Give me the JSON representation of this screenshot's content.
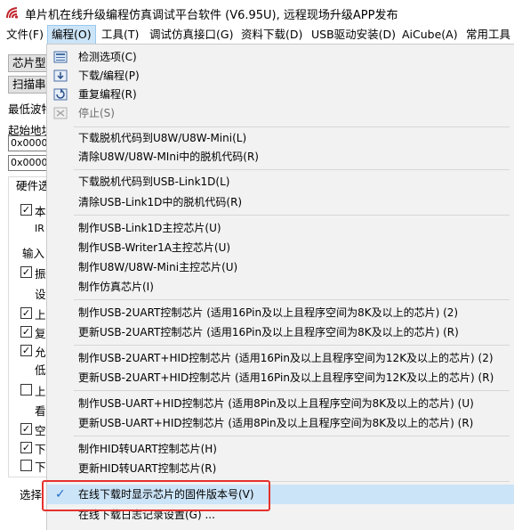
{
  "window": {
    "title": "单片机在线升级编程仿真调试平台软件 (V6.95U), 远程现场升级APP发布"
  },
  "menubar": {
    "items": [
      {
        "label": "文件(F)"
      },
      {
        "label": "编程(O)"
      },
      {
        "label": "工具(T)"
      },
      {
        "label": "调试仿真接口(G)"
      },
      {
        "label": "资料下载(D)"
      },
      {
        "label": "USB驱动安装(D)"
      },
      {
        "label": "AiCube(A)"
      },
      {
        "label": "常用工具"
      }
    ]
  },
  "background": {
    "chip_type_button": "芯片型",
    "scan_button": "扫描串",
    "min_baud_label": "最低波特",
    "start_addr_label": "起始地址",
    "addr1": "0x0000",
    "addr2": "0x0000",
    "hardware_tab": "硬件选",
    "row_labels": [
      "本",
      "IR",
      "输入",
      "振",
      "设",
      "上",
      "复",
      "允",
      "低",
      "上",
      "看",
      "空",
      "下",
      "下"
    ],
    "select_label": "选择"
  },
  "menu": {
    "items": [
      {
        "label": "检测选项(C)",
        "icon": "detect-icon",
        "disabled": false
      },
      {
        "label": "下载/编程(P)",
        "icon": "download-program-icon",
        "disabled": false
      },
      {
        "label": "重复编程(R)",
        "icon": "repeat-program-icon",
        "disabled": false
      },
      {
        "label": "停止(S)",
        "icon": "stop-icon",
        "disabled": true
      },
      {
        "label": "下载脱机代码到U8W/U8W-Mini(L)"
      },
      {
        "label": "清除U8W/U8W-MIni中的脱机代码(R)"
      },
      {
        "label": "下载脱机代码到USB-Link1D(L)"
      },
      {
        "label": "清除USB-Link1D中的脱机代码(R)"
      },
      {
        "label": "制作USB-Link1D主控芯片(U)"
      },
      {
        "label": "制作USB-Writer1A主控芯片(U)"
      },
      {
        "label": "制作U8W/U8W-Mini主控芯片(U)"
      },
      {
        "label": "制作仿真芯片(I)"
      },
      {
        "label": "制作USB-2UART控制芯片 (适用16Pin及以上且程序空间为8K及以上的芯片) (2)"
      },
      {
        "label": "更新USB-2UART控制芯片 (适用16Pin及以上且程序空间为8K及以上的芯片) (R)"
      },
      {
        "label": "制作USB-2UART+HID控制芯片 (适用16Pin及以上且程序空间为12K及以上的芯片) (2)"
      },
      {
        "label": "更新USB-2UART+HID控制芯片 (适用16Pin及以上且程序空间为12K及以上的芯片) (R)"
      },
      {
        "label": "制作USB-UART+HID控制芯片 (适用8Pin及以上且程序空间为8K及以上的芯片) (U)"
      },
      {
        "label": "更新USB-UART+HID控制芯片 (适用8Pin及以上且程序空间为8K及以上的芯片) (R)"
      },
      {
        "label": "制作HID转UART控制芯片(H)"
      },
      {
        "label": "更新HID转UART控制芯片(R)"
      },
      {
        "label": "在线下载时显示芯片的固件版本号(V)",
        "checked": true
      },
      {
        "label": "在线下载日志记录设置(G) ..."
      }
    ]
  },
  "colors": {
    "menu_bg": "#f2f2f2",
    "active_menu_bg": "#cce4f7",
    "highlight_border": "#e5322d",
    "checkmark": "#1e6fd0"
  }
}
